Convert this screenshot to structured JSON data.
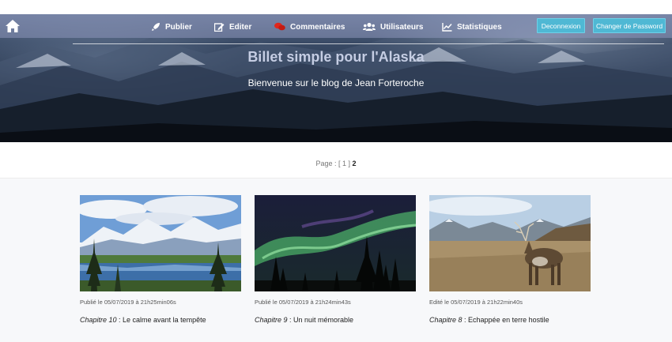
{
  "nav": {
    "items": [
      {
        "label": "Publier",
        "icon": "rocket-icon"
      },
      {
        "label": "Editer",
        "icon": "edit-icon"
      },
      {
        "label": "Commentaires",
        "icon": "comments-icon"
      },
      {
        "label": "Utilisateurs",
        "icon": "users-icon"
      },
      {
        "label": "Statistiques",
        "icon": "chart-icon"
      }
    ],
    "logout_label": "Deconnexion",
    "password_label": "Changer de Password"
  },
  "hero": {
    "title": "Billet simple pour l'Alaska",
    "subtitle": "Bienvenue sur le blog de Jean Forteroche"
  },
  "pagination": {
    "prefix": "Page :",
    "page1": "[ 1 ]",
    "current": "2"
  },
  "posts": [
    {
      "meta": "Publié le 05/07/2019 à 21h25min06s",
      "chapter": "Chapitre 10",
      "title": " : Le calme avant la tempête",
      "image": "lake-mountains-image"
    },
    {
      "meta": "Publié le 05/07/2019 à 21h24min43s",
      "chapter": "Chapitre 9",
      "title": " : Un nuit mémorable",
      "image": "aurora-image"
    },
    {
      "meta": "Edité le 05/07/2019 à 21h22min40s",
      "chapter": "Chapitre 8",
      "title": " : Echappée en terre hostile",
      "image": "caribou-image"
    }
  ],
  "colors": {
    "accent_button": "#4fb8d4",
    "nav_overlay": "#8c96b9",
    "comments_icon": "#e0261b"
  }
}
